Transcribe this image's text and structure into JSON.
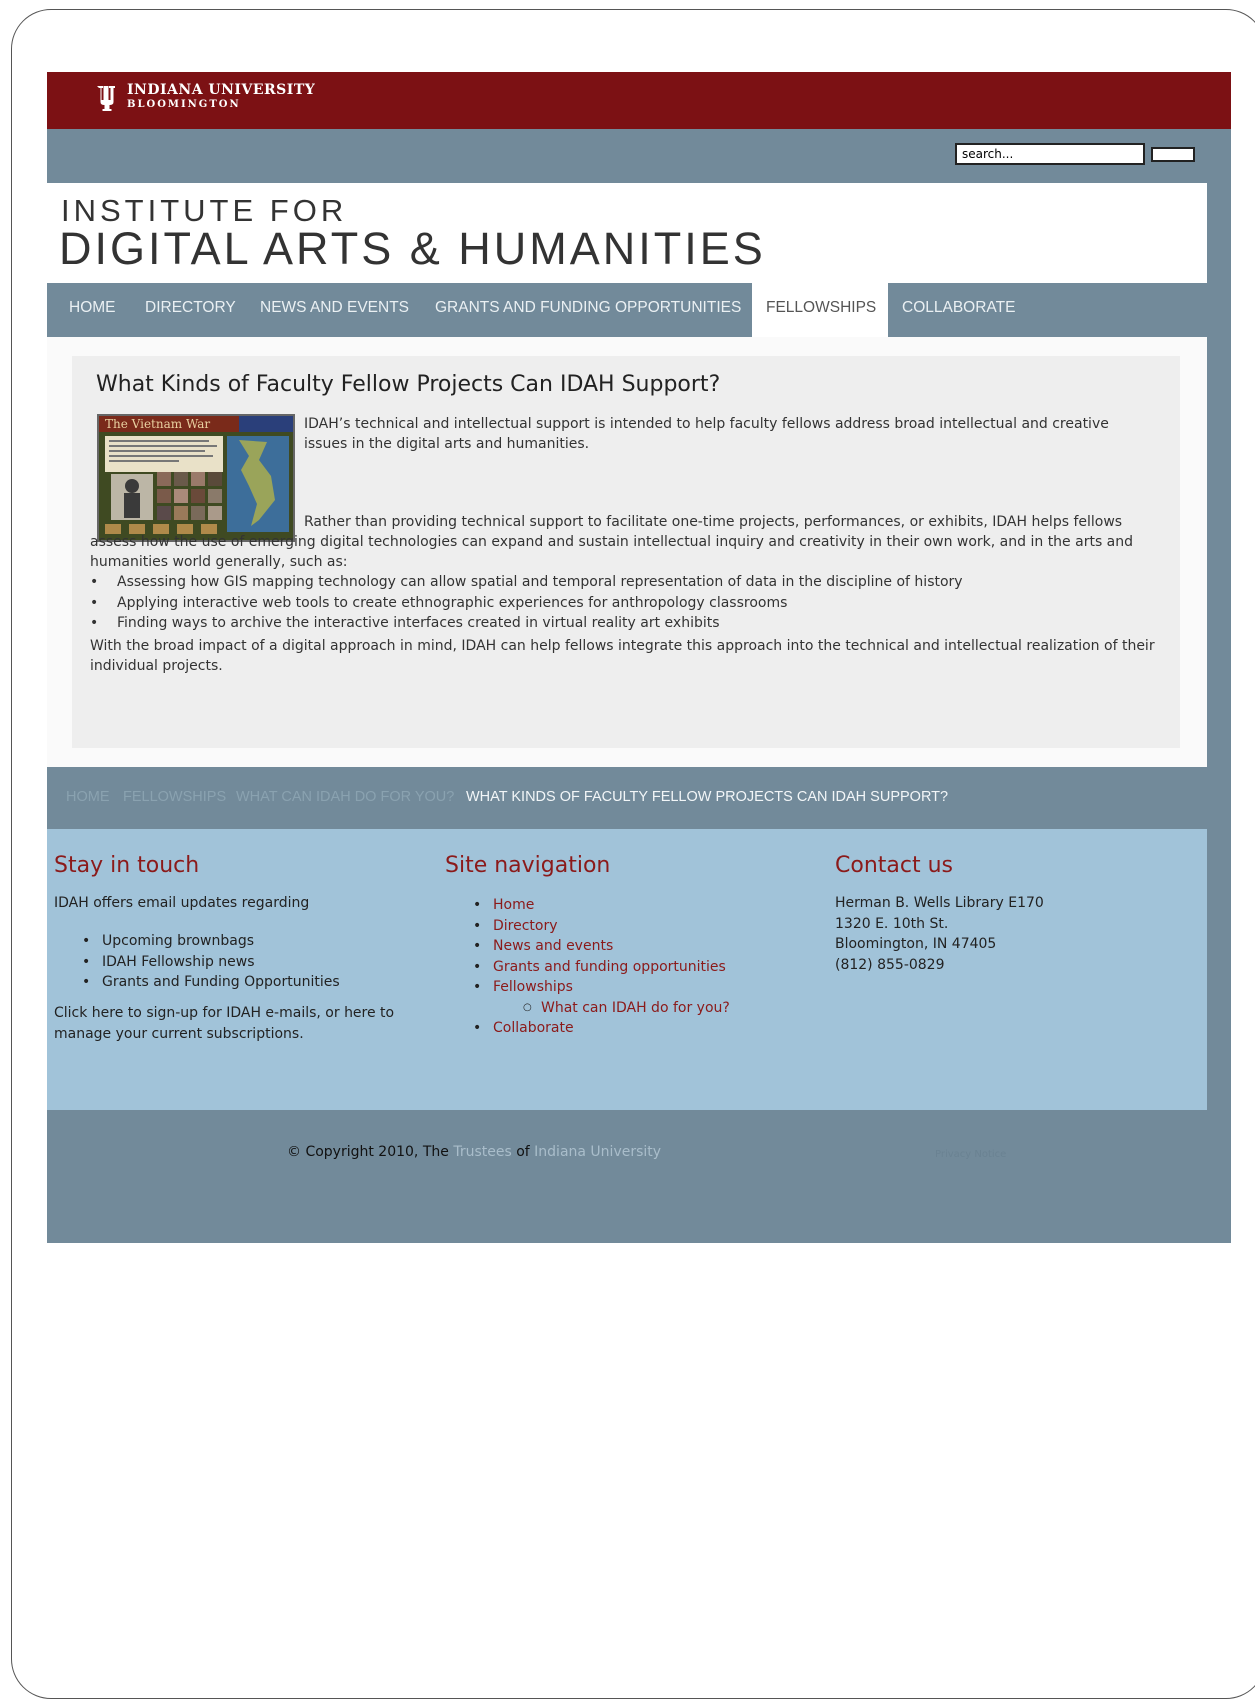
{
  "iu": {
    "line1": "INDIANA UNIVERSITY",
    "line2": "BLOOMINGTON"
  },
  "search": {
    "value": "search..."
  },
  "banner": {
    "line1": "INSTITUTE FOR",
    "line2": "DIGITAL ARTS & HUMANITIES"
  },
  "nav": {
    "items": [
      "HOME",
      "DIRECTORY",
      "NEWS AND EVENTS",
      "GRANTS AND FUNDING OPPORTUNITIES",
      "FELLOWSHIPS",
      "COLLABORATE"
    ],
    "active": "FELLOWSHIPS"
  },
  "article": {
    "title": "What Kinds of Faculty Fellow Projects Can IDAH Support?",
    "image_title": "The Vietnam War",
    "p1": "IDAH’s technical and intellectual support is intended to help faculty fellows address broad intellectual and creative issues in the digital arts and humanities.",
    "p2": "Rather than providing technical support to facilitate one-time projects, performances, or exhibits, IDAH helps fellows assess how the use of emerging digital technologies can expand and sustain intellectual inquiry and creativity in their own work, and in the arts and humanities world generally, such as:",
    "bullets": [
      "Assessing how GIS mapping technology can allow spatial and temporal  representation of data in the discipline of history",
      "Applying interactive web tools to create ethnographic experiences for anthropology classrooms",
      "Finding ways to archive the interactive interfaces created in virtual reality art exhibits"
    ],
    "p3": "With the broad impact of a digital approach in mind, IDAH can help fellows integrate this approach into the technical and intellectual realization of their individual projects."
  },
  "breadcrumbs": [
    "HOME",
    "FELLOWSHIPS",
    "WHAT CAN IDAH DO FOR YOU?",
    "WHAT KINDS OF FACULTY FELLOW PROJECTS CAN IDAH SUPPORT?"
  ],
  "footer": {
    "stay": {
      "heading": "Stay in touch",
      "intro": "IDAH offers email updates regarding",
      "items": [
        "Upcoming brownbags",
        "IDAH Fellowship news",
        "Grants and Funding Opportunities"
      ],
      "signup": "Click here to sign-up for IDAH e-mails, or here to manage your current subscriptions."
    },
    "sitenav": {
      "heading": "Site navigation",
      "items": [
        "Home",
        "Directory",
        "News and events",
        "Grants and funding opportunities",
        "Fellowships"
      ],
      "subitem": "What can IDAH do for you?",
      "last": "Collaborate"
    },
    "contact": {
      "heading": "Contact us",
      "lines": [
        "Herman B. Wells Library E170",
        "1320 E. 10th St.",
        "Bloomington, IN 47405",
        "(812) 855-0829"
      ]
    }
  },
  "copyright": {
    "prefix": "© Copyright 2010, The ",
    "trustees": "Trustees",
    "of": " of ",
    "iu": "Indiana University",
    "small_link": "Privacy Notice"
  },
  "colors": {
    "iu_crimson": "#7c1114",
    "slate": "#728a9a",
    "light_blue": "#a1c3d9",
    "heading_red": "#8b1a1a"
  }
}
